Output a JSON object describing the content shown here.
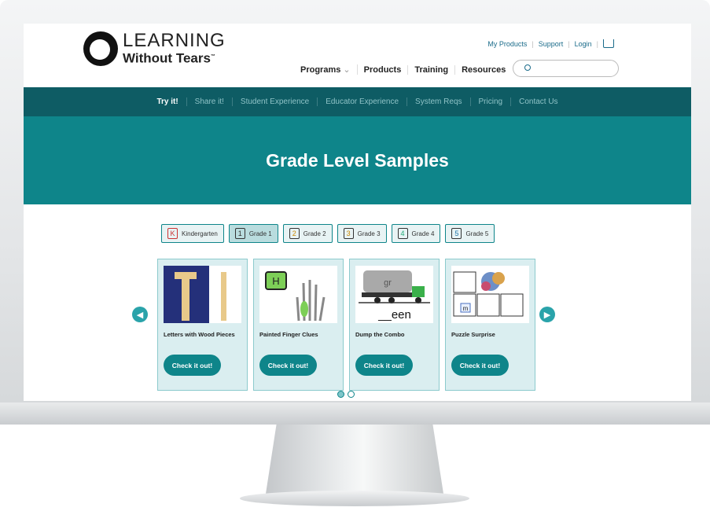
{
  "brand": {
    "line1": "LEARNING",
    "line2": "Without Tears",
    "tm": "™"
  },
  "top_links": [
    "My Products",
    "Support",
    "Login"
  ],
  "main_nav": [
    "Programs",
    "Products",
    "Training",
    "Resources"
  ],
  "search": {
    "placeholder": ""
  },
  "sub_nav": [
    {
      "label": "Try it!",
      "active": true
    },
    {
      "label": "Share it!"
    },
    {
      "label": "Student Experience"
    },
    {
      "label": "Educator Experience"
    },
    {
      "label": "System Reqs"
    },
    {
      "label": "Pricing"
    },
    {
      "label": "Contact Us"
    }
  ],
  "hero": {
    "title": "Grade Level Samples"
  },
  "grades": [
    {
      "glyph": "K",
      "label": "Kindergarten",
      "selected": false
    },
    {
      "glyph": "1",
      "label": "Grade 1",
      "selected": true
    },
    {
      "glyph": "2",
      "label": "Grade 2",
      "selected": false
    },
    {
      "glyph": "3",
      "label": "Grade 3",
      "selected": false
    },
    {
      "glyph": "4",
      "label": "Grade 4",
      "selected": false
    },
    {
      "glyph": "5",
      "label": "Grade 5",
      "selected": false
    }
  ],
  "cards": [
    {
      "title": "Letters with Wood Pieces",
      "button": "Check it out!"
    },
    {
      "title": "Painted Finger Clues",
      "button": "Check it out!",
      "tile": "H"
    },
    {
      "title": "Dump the Combo",
      "button": "Check it out!",
      "truck_label": "gr",
      "word": "__een"
    },
    {
      "title": "Puzzle Surprise",
      "button": "Check it out!",
      "piece": "m"
    }
  ],
  "colors": {
    "teal": "#0e858a",
    "dark_teal": "#0e5c64",
    "card_bg": "#daeef0"
  }
}
